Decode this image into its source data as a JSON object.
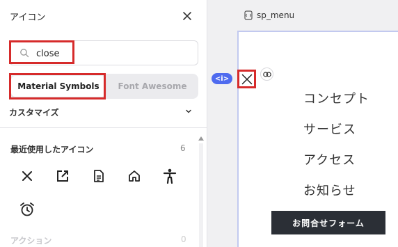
{
  "panel": {
    "title": "アイコン",
    "search": {
      "value": "close",
      "placeholder": ""
    },
    "tabs": [
      {
        "label": "Material Symbols",
        "active": true
      },
      {
        "label": "Font Awesome",
        "active": false
      }
    ],
    "customize_label": "カスタマイズ",
    "recent": {
      "title": "最近使用したアイコン",
      "count": "6",
      "icons": [
        "close-icon",
        "open-in-new-icon",
        "description-icon",
        "home-icon",
        "accessibility-icon",
        "alarm-icon"
      ]
    },
    "next_section": {
      "title": "アクション",
      "count": "0"
    }
  },
  "canvas": {
    "frame_label": "sp_menu",
    "tag_label": "<i>",
    "menu_items": [
      "コンセプト",
      "サービス",
      "アクセス",
      "お知らせ"
    ],
    "form_button": "お問合せフォーム"
  },
  "colors": {
    "highlight": "#d62b2b",
    "accent": "#4f6bef",
    "button_dark": "#2b2f36"
  }
}
